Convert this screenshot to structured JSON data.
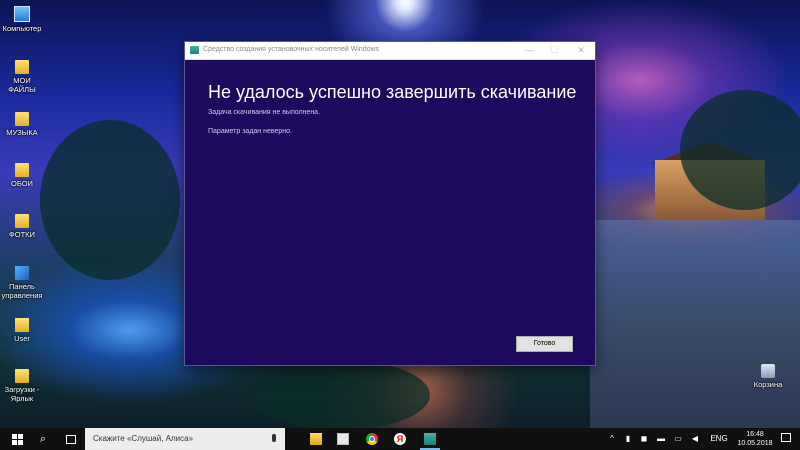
{
  "desktop": {
    "icons": [
      {
        "label": "Компьютер",
        "icon": "computer-icon"
      },
      {
        "label": "МОИ ФАЙЛЫ",
        "icon": "folder-icon"
      },
      {
        "label": "МУЗЫКА",
        "icon": "folder-icon"
      },
      {
        "label": "ОБОИ",
        "icon": "folder-icon"
      },
      {
        "label": "ФОТКИ",
        "icon": "folder-icon"
      },
      {
        "label": "Панель управления",
        "icon": "control-panel-icon"
      },
      {
        "label": "User",
        "icon": "user-folder-icon"
      },
      {
        "label": "Загрузки - Ярлык",
        "icon": "downloads-shortcut-icon"
      },
      {
        "label": "Корзина",
        "icon": "recycle-bin-icon"
      }
    ]
  },
  "dialog": {
    "title": "Средство создания установочных носителей Windows",
    "heading": "Не удалось успешно завершить скачивание",
    "subtitle": "Задача скачивания не выполнена.",
    "error": "Параметр задан неверно.",
    "done_label": "Готово",
    "minimize_glyph": "—",
    "maximize_glyph": "☐",
    "close_glyph": "✕"
  },
  "taskbar": {
    "search_placeholder": "Скажите «Слушай, Алиса»",
    "search_glyph": "⌕",
    "yandex_glyph": "Я",
    "apps": [
      "file-explorer-icon",
      "store-icon",
      "chrome-icon",
      "yandex-browser-icon",
      "media-creation-tool-icon"
    ],
    "tray": {
      "chevron": "^",
      "language": "ENG",
      "time": "16:48",
      "date": "10.05.2018"
    }
  },
  "colors": {
    "dialog_bg": "#1d0a5e",
    "taskbar_bg": "#101010",
    "active_indicator": "#76b9ed"
  }
}
